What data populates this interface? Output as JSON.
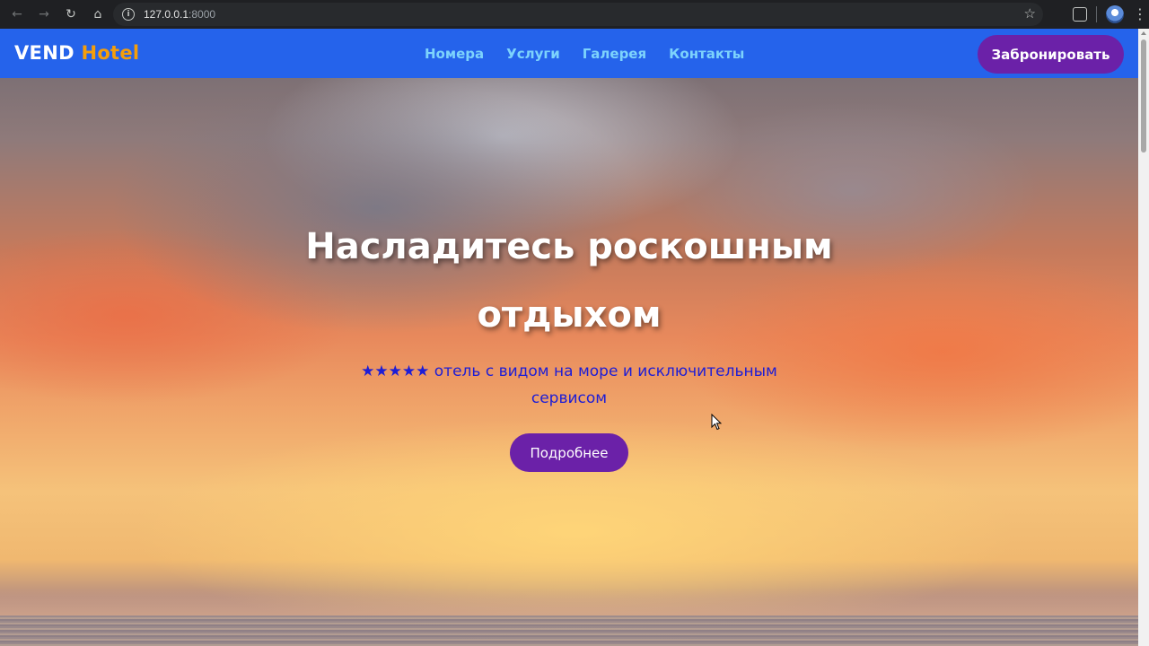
{
  "browser": {
    "url_host": "127.0.0.1",
    "url_port": ":8000",
    "icons": [
      "back-arrow-icon",
      "forward-arrow-icon",
      "reload-icon",
      "home-icon",
      "site-info-icon",
      "bookmark-star-icon",
      "extensions-icon",
      "profile-avatar",
      "menu-kebab-icon"
    ]
  },
  "header": {
    "logo_main": "VEND",
    "logo_accent": "Hotel",
    "nav": [
      "Номера",
      "Услуги",
      "Галерея",
      "Контакты"
    ],
    "book_label": "Забронировать"
  },
  "hero": {
    "title_line1": "Насладитесь роскошным",
    "title_line2": "отдыхом",
    "stars": "★★★★★",
    "subtitle": "отель с видом на море и исключительным сервисом",
    "button_label": "Подробнее"
  },
  "colors": {
    "header_bg": "#2563eb",
    "logo_accent": "#f59e0b",
    "nav_link": "#7dd3fc",
    "button_bg": "#6b21a8",
    "subtitle_text": "#1d1dd6"
  }
}
